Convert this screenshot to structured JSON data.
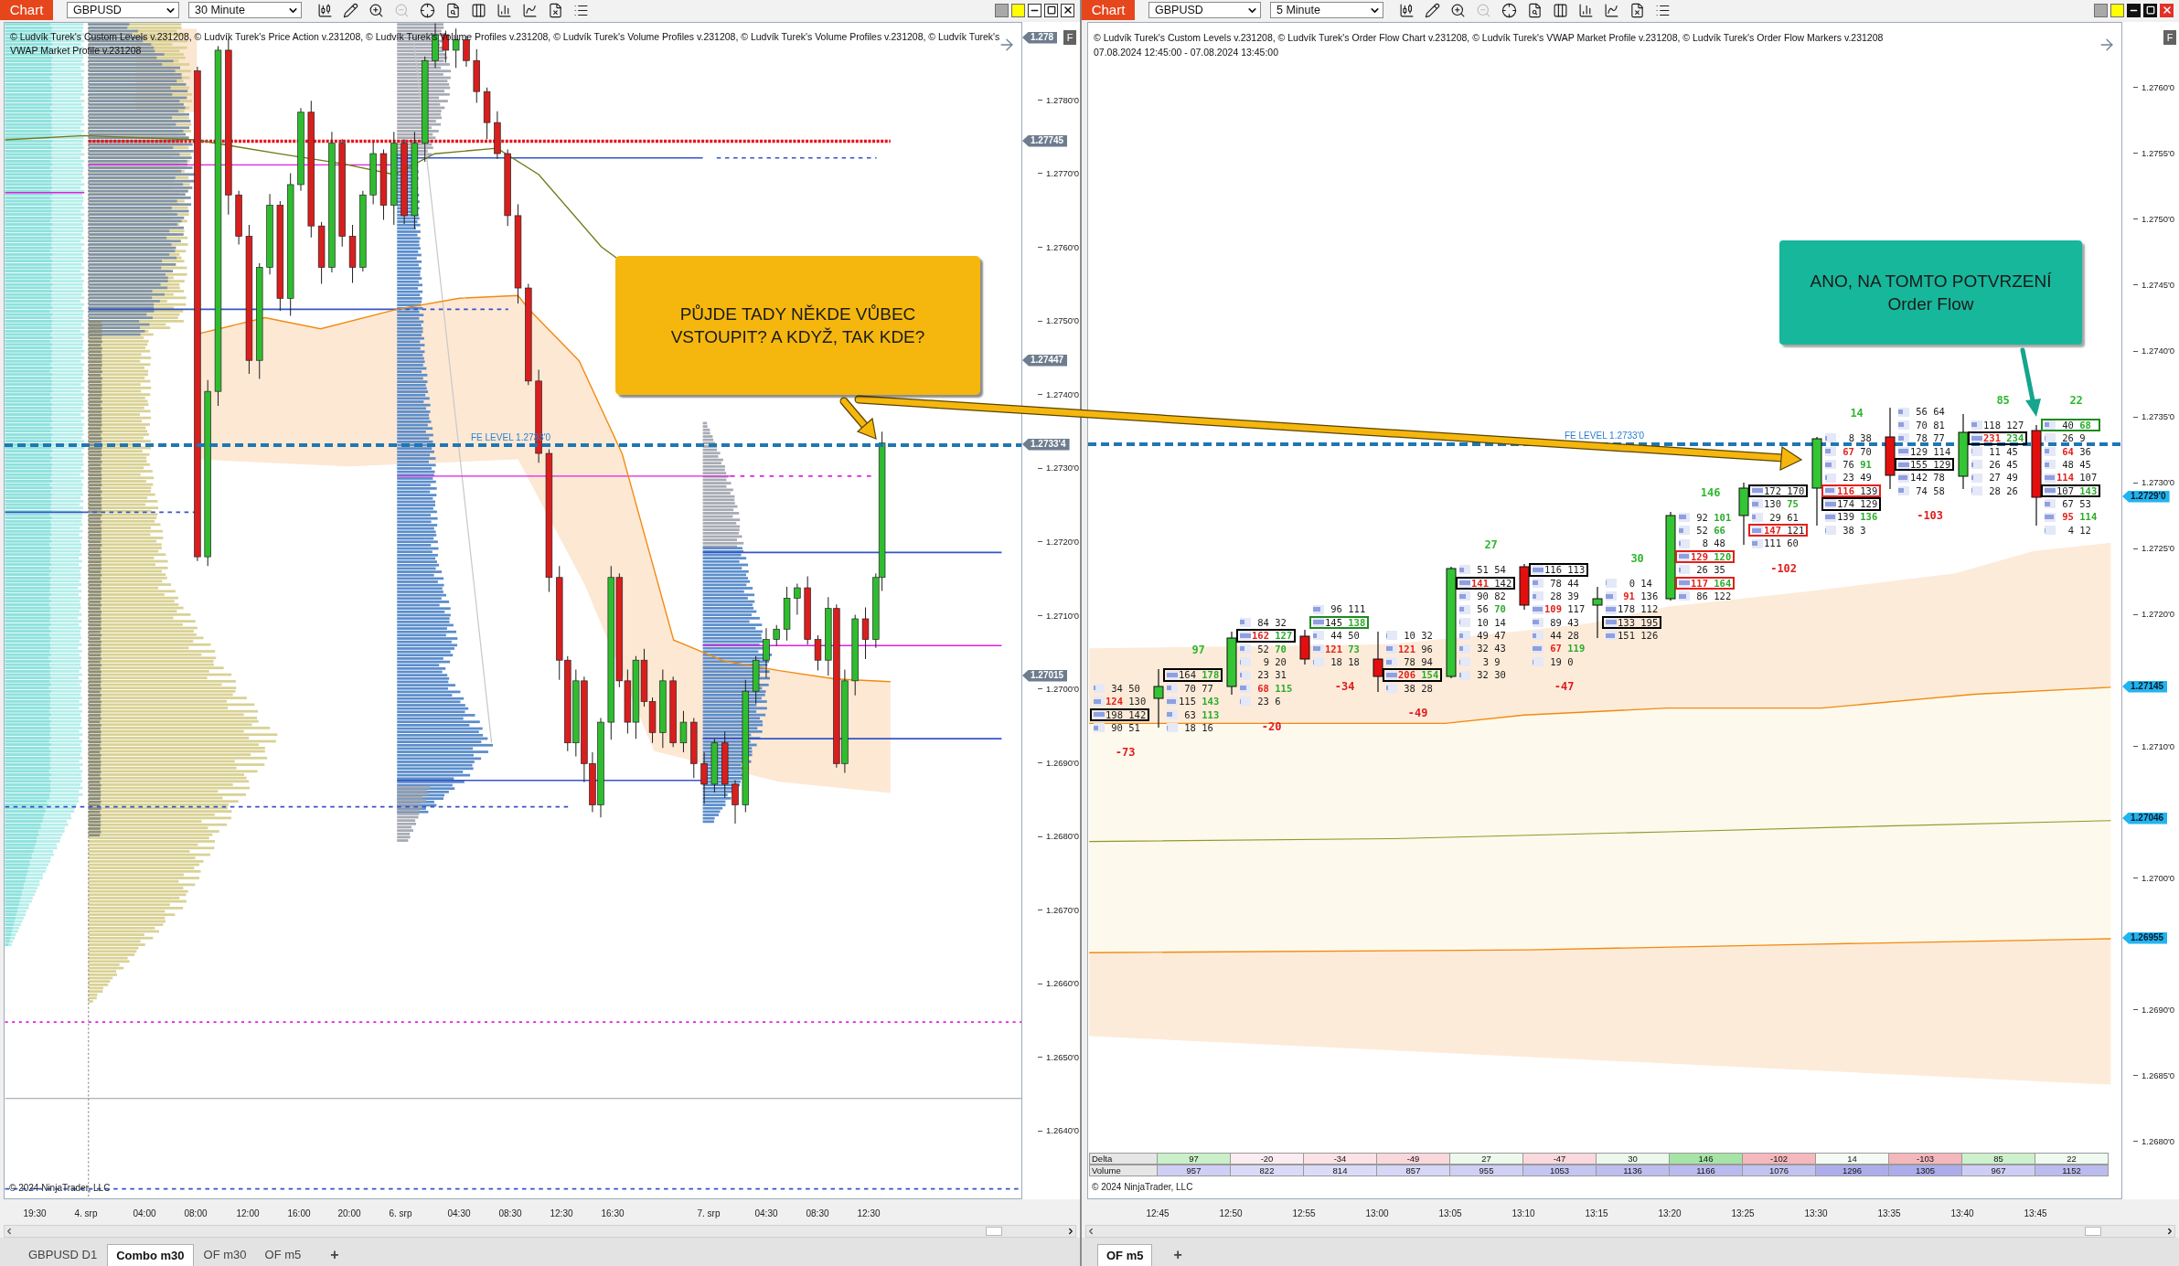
{
  "left_window": {
    "active": false,
    "toolbar": {
      "title": "Chart",
      "instrument": "GBPUSD",
      "timeframe": "30 Minute",
      "tools": [
        {
          "disabled": false
        },
        {
          "disabled": false
        },
        {
          "disabled": false
        },
        {
          "disabled": true
        },
        {
          "disabled": false
        },
        {
          "disabled": false
        },
        {
          "disabled": false
        },
        {
          "disabled": false
        },
        {
          "disabled": false
        },
        {
          "disabled": false
        },
        {
          "disabled": false
        }
      ],
      "links": [
        {
          "color": "#a9a9a9"
        },
        {
          "color": "#ffff00"
        }
      ]
    },
    "header_lines": [
      "© Ludvík Turek's Custom Levels v.231208, © Ludvík Turek's Price Action v.231208, © Ludvík Turek's Volume Profiles v.231208, © Ludvík Turek's Volume Profiles v.231208, © Ludvík Turek's Volume Profiles v.231208, © Ludvík Turek's",
      "VWAP Market Profile v.231208"
    ],
    "axis_button": "F",
    "fe_level_label": "FE LEVEL 1.2733'0",
    "price_ticks": [
      "1.2780'0",
      "1.2770'0",
      "1.2760'0",
      "1.2750'0",
      "1.2740'0",
      "1.2730'0",
      "1.2720'0",
      "1.2710'0",
      "1.2700'0",
      "1.2690'0",
      "1.2680'0",
      "1.2670'0",
      "1.2660'0",
      "1.2650'0",
      "1.2640'0"
    ],
    "price_markers": [
      "1.278",
      "1.27745",
      "1.27447",
      "1.2733'4",
      "1.27015"
    ],
    "copyright": "© 2024 NinjaTrader, LLC",
    "time_labels": [
      "19:30",
      "4. srp",
      "04:00",
      "08:00",
      "12:00",
      "16:00",
      "20:00",
      "6. srp",
      "04:30",
      "08:30",
      "12:30",
      "16:30",
      "7. srp",
      "04:30",
      "08:30",
      "12:30"
    ],
    "tabs": [
      {
        "label": "GBPUSD D1",
        "selected": false
      },
      {
        "label": "Combo m30",
        "selected": true
      },
      {
        "label": "OF m30",
        "selected": false
      },
      {
        "label": "OF m5",
        "selected": false
      }
    ],
    "add_tab": "+"
  },
  "right_window": {
    "active": true,
    "toolbar": {
      "title": "Chart",
      "instrument": "GBPUSD",
      "timeframe": "5 Minute",
      "tools": [
        {
          "disabled": false
        },
        {
          "disabled": false
        },
        {
          "disabled": false
        },
        {
          "disabled": true
        },
        {
          "disabled": false
        },
        {
          "disabled": false
        },
        {
          "disabled": false
        },
        {
          "disabled": false
        },
        {
          "disabled": false
        },
        {
          "disabled": false
        },
        {
          "disabled": false
        }
      ],
      "links": [
        {
          "color": "#a9a9a9"
        },
        {
          "color": "#ffff00"
        }
      ]
    },
    "header_lines": [
      "© Ludvík Turek's Custom Levels v.231208, © Ludvík Turek's Order Flow Chart v.231208, © Ludvík Turek's VWAP Market Profile v.231208, © Ludvík Turek's Order Flow Markers v.231208",
      "07.08.2024 12:45:00 - 07.08.2024 13:45:00"
    ],
    "axis_button": "F",
    "fe_level_label": "FE LEVEL 1.2733'0",
    "price_ticks": [
      "1.2760'0",
      "1.2755'0",
      "1.2750'0",
      "1.2745'0",
      "1.2740'0",
      "1.2735'0",
      "1.2730'0",
      "1.2725'0",
      "1.2720'0",
      "1.2710'0",
      "1.2700'0",
      "1.2690'0",
      "1.2685'0",
      "1.2680'0"
    ],
    "price_markers": [
      "1.2729'0",
      "1.27145",
      "1.27046",
      "1.26955"
    ],
    "footprint": [
      {
        "delta": "-73",
        "delta_positive": false,
        "rows": [
          {
            "bid": "34",
            "ask": "50",
            "bid_imbalance": false,
            "ask_imbalance": false,
            "level": 0.2
          },
          {
            "bid": "124",
            "ask": "130",
            "bid_imbalance": true,
            "ask_imbalance": false,
            "level": 0.7
          },
          {
            "bid": "198",
            "ask": "142",
            "bid_imbalance": false,
            "ask_imbalance": false,
            "level": 1,
            "color": "#000000"
          },
          {
            "bid": "90",
            "ask": "51",
            "bid_imbalance": false,
            "ask_imbalance": false,
            "level": 0.4
          }
        ]
      },
      {
        "delta": "97",
        "delta_positive": true,
        "rows": [
          {
            "bid": "164",
            "ask": "178",
            "bid_imbalance": false,
            "ask_imbalance": true,
            "level": 1,
            "color": "#000000"
          },
          {
            "bid": "70",
            "ask": "77",
            "bid_imbalance": false,
            "ask_imbalance": false,
            "level": 0.4
          },
          {
            "bid": "115",
            "ask": "143",
            "bid_imbalance": false,
            "ask_imbalance": true,
            "level": 0.8
          },
          {
            "bid": "63",
            "ask": "113",
            "bid_imbalance": false,
            "ask_imbalance": true,
            "level": 0.5
          },
          {
            "bid": "18",
            "ask": "16",
            "bid_imbalance": false,
            "ask_imbalance": false,
            "level": 0.1
          }
        ]
      },
      {
        "delta": "-20",
        "delta_positive": false,
        "rows": [
          {
            "bid": "84",
            "ask": "32",
            "bid_imbalance": false,
            "ask_imbalance": false,
            "level": 0.4
          },
          {
            "bid": "162",
            "ask": "127",
            "bid_imbalance": true,
            "ask_imbalance": true,
            "level": 1,
            "color": "#000000"
          },
          {
            "bid": "52",
            "ask": "70",
            "bid_imbalance": false,
            "ask_imbalance": true,
            "level": 0.4
          },
          {
            "bid": "9",
            "ask": "20",
            "bid_imbalance": false,
            "ask_imbalance": false,
            "level": 0.1
          },
          {
            "bid": "23",
            "ask": "31",
            "bid_imbalance": false,
            "ask_imbalance": false,
            "level": 0.2
          },
          {
            "bid": "68",
            "ask": "115",
            "bid_imbalance": true,
            "ask_imbalance": true,
            "level": 0.6
          },
          {
            "bid": "23",
            "ask": "6",
            "bid_imbalance": false,
            "ask_imbalance": false,
            "level": 0.1
          }
        ]
      },
      {
        "delta": "-34",
        "delta_positive": false,
        "rows": [
          {
            "bid": "96",
            "ask": "111",
            "bid_imbalance": false,
            "ask_imbalance": false,
            "level": 0.7
          },
          {
            "bid": "145",
            "ask": "138",
            "bid_imbalance": false,
            "ask_imbalance": true,
            "level": 1,
            "color": "#1e8c1e"
          },
          {
            "bid": "44",
            "ask": "50",
            "bid_imbalance": false,
            "ask_imbalance": false,
            "level": 0.3
          },
          {
            "bid": "121",
            "ask": "73",
            "bid_imbalance": true,
            "ask_imbalance": true,
            "level": 0.7
          },
          {
            "bid": "18",
            "ask": "18",
            "bid_imbalance": false,
            "ask_imbalance": false,
            "level": 0.1
          }
        ]
      },
      {
        "delta": "-49",
        "delta_positive": false,
        "rows": [
          {
            "bid": "10",
            "ask": "32",
            "bid_imbalance": false,
            "ask_imbalance": false,
            "level": 0.1
          },
          {
            "bid": "121",
            "ask": "96",
            "bid_imbalance": true,
            "ask_imbalance": false,
            "level": 0.6
          },
          {
            "bid": "78",
            "ask": "94",
            "bid_imbalance": false,
            "ask_imbalance": false,
            "level": 0.5
          },
          {
            "bid": "206",
            "ask": "154",
            "bid_imbalance": true,
            "ask_imbalance": true,
            "level": 1,
            "color": "#000000"
          },
          {
            "bid": "38",
            "ask": "28",
            "bid_imbalance": false,
            "ask_imbalance": false,
            "level": 0.2
          }
        ]
      },
      {
        "delta": "27",
        "delta_positive": true,
        "rows": [
          {
            "bid": "51",
            "ask": "54",
            "bid_imbalance": false,
            "ask_imbalance": false,
            "level": 0.4
          },
          {
            "bid": "141",
            "ask": "142",
            "bid_imbalance": true,
            "ask_imbalance": false,
            "level": 1,
            "color": "#000000"
          },
          {
            "bid": "90",
            "ask": "82",
            "bid_imbalance": false,
            "ask_imbalance": false,
            "level": 0.6
          },
          {
            "bid": "56",
            "ask": "70",
            "bid_imbalance": false,
            "ask_imbalance": true,
            "level": 0.4
          },
          {
            "bid": "10",
            "ask": "14",
            "bid_imbalance": false,
            "ask_imbalance": false,
            "level": 0.1
          },
          {
            "bid": "49",
            "ask": "47",
            "bid_imbalance": false,
            "ask_imbalance": false,
            "level": 0.3
          },
          {
            "bid": "32",
            "ask": "43",
            "bid_imbalance": false,
            "ask_imbalance": false,
            "level": 0.3
          },
          {
            "bid": "3",
            "ask": "9",
            "bid_imbalance": false,
            "ask_imbalance": false,
            "level": 0.1
          },
          {
            "bid": "32",
            "ask": "30",
            "bid_imbalance": false,
            "ask_imbalance": false,
            "level": 0.2
          }
        ]
      },
      {
        "delta": "-47",
        "delta_positive": false,
        "rows": [
          {
            "bid": "116",
            "ask": "113",
            "bid_imbalance": false,
            "ask_imbalance": false,
            "level": 1,
            "color": "#000000"
          },
          {
            "bid": "78",
            "ask": "44",
            "bid_imbalance": false,
            "ask_imbalance": false,
            "level": 0.5
          },
          {
            "bid": "28",
            "ask": "39",
            "bid_imbalance": false,
            "ask_imbalance": false,
            "level": 0.3
          },
          {
            "bid": "109",
            "ask": "117",
            "bid_imbalance": true,
            "ask_imbalance": false,
            "level": 0.9
          },
          {
            "bid": "89",
            "ask": "43",
            "bid_imbalance": false,
            "ask_imbalance": false,
            "level": 0.6
          },
          {
            "bid": "44",
            "ask": "28",
            "bid_imbalance": false,
            "ask_imbalance": false,
            "level": 0.3
          },
          {
            "bid": "67",
            "ask": "119",
            "bid_imbalance": true,
            "ask_imbalance": true,
            "level": 0.8
          },
          {
            "bid": "19",
            "ask": "0",
            "bid_imbalance": false,
            "ask_imbalance": false,
            "level": 0.1
          }
        ]
      },
      {
        "delta": "30",
        "delta_positive": true,
        "rows": [
          {
            "bid": "0",
            "ask": "14",
            "bid_imbalance": false,
            "ask_imbalance": false,
            "level": 0.1
          },
          {
            "bid": "91",
            "ask": "136",
            "bid_imbalance": true,
            "ask_imbalance": false,
            "level": 0.7
          },
          {
            "bid": "178",
            "ask": "112",
            "bid_imbalance": false,
            "ask_imbalance": false,
            "level": 0.9
          },
          {
            "bid": "133",
            "ask": "195",
            "bid_imbalance": false,
            "ask_imbalance": false,
            "level": 1,
            "color": "#000000"
          },
          {
            "bid": "151",
            "ask": "126",
            "bid_imbalance": false,
            "ask_imbalance": false,
            "level": 0.8
          }
        ]
      },
      {
        "delta": "146",
        "delta_positive": true,
        "rows": [
          {
            "bid": "92",
            "ask": "101",
            "bid_imbalance": false,
            "ask_imbalance": true,
            "level": 0.7
          },
          {
            "bid": "52",
            "ask": "66",
            "bid_imbalance": false,
            "ask_imbalance": true,
            "level": 0.4
          },
          {
            "bid": "8",
            "ask": "48",
            "bid_imbalance": false,
            "ask_imbalance": false,
            "level": 0.2
          },
          {
            "bid": "129",
            "ask": "120",
            "bid_imbalance": true,
            "ask_imbalance": true,
            "level": 0.9,
            "color": "#e3201b"
          },
          {
            "bid": "26",
            "ask": "35",
            "bid_imbalance": false,
            "ask_imbalance": false,
            "level": 0.2
          },
          {
            "bid": "117",
            "ask": "164",
            "bid_imbalance": true,
            "ask_imbalance": true,
            "level": 1,
            "color": "#e3201b"
          },
          {
            "bid": "86",
            "ask": "122",
            "bid_imbalance": false,
            "ask_imbalance": false,
            "level": 0.7
          }
        ]
      },
      {
        "delta": "-102",
        "delta_positive": false,
        "rows": [
          {
            "bid": "172",
            "ask": "170",
            "bid_imbalance": false,
            "ask_imbalance": false,
            "level": 1,
            "color": "#000000"
          },
          {
            "bid": "130",
            "ask": "75",
            "bid_imbalance": false,
            "ask_imbalance": true,
            "level": 0.6
          },
          {
            "bid": "29",
            "ask": "61",
            "bid_imbalance": false,
            "ask_imbalance": false,
            "level": 0.3
          },
          {
            "bid": "147",
            "ask": "121",
            "bid_imbalance": true,
            "ask_imbalance": false,
            "level": 0.8,
            "color": "#e3201b"
          },
          {
            "bid": "111",
            "ask": "60",
            "bid_imbalance": false,
            "ask_imbalance": false,
            "level": 0.5
          }
        ]
      },
      {
        "delta": "14",
        "delta_positive": true,
        "rows": [
          {
            "bid": "8",
            "ask": "38",
            "bid_imbalance": false,
            "ask_imbalance": false,
            "level": 0.2
          },
          {
            "bid": "67",
            "ask": "70",
            "bid_imbalance": true,
            "ask_imbalance": false,
            "level": 0.5
          },
          {
            "bid": "76",
            "ask": "91",
            "bid_imbalance": false,
            "ask_imbalance": true,
            "level": 0.6
          },
          {
            "bid": "23",
            "ask": "49",
            "bid_imbalance": false,
            "ask_imbalance": false,
            "level": 0.2
          },
          {
            "bid": "116",
            "ask": "139",
            "bid_imbalance": true,
            "ask_imbalance": false,
            "level": 0.8,
            "color": "#e3201b"
          },
          {
            "bid": "174",
            "ask": "129",
            "bid_imbalance": false,
            "ask_imbalance": false,
            "level": 1,
            "color": "#000000"
          },
          {
            "bid": "139",
            "ask": "136",
            "bid_imbalance": false,
            "ask_imbalance": true,
            "level": 0.9
          },
          {
            "bid": "38",
            "ask": "3",
            "bid_imbalance": false,
            "ask_imbalance": false,
            "level": 0.1
          }
        ]
      },
      {
        "delta": "-103",
        "delta_positive": false,
        "rows": [
          {
            "bid": "56",
            "ask": "64",
            "bid_imbalance": false,
            "ask_imbalance": false,
            "level": 0.4
          },
          {
            "bid": "70",
            "ask": "81",
            "bid_imbalance": false,
            "ask_imbalance": false,
            "level": 0.5
          },
          {
            "bid": "78",
            "ask": "77",
            "bid_imbalance": false,
            "ask_imbalance": false,
            "level": 0.5
          },
          {
            "bid": "129",
            "ask": "114",
            "bid_imbalance": false,
            "ask_imbalance": false,
            "level": 0.9
          },
          {
            "bid": "155",
            "ask": "129",
            "bid_imbalance": false,
            "ask_imbalance": false,
            "level": 1,
            "color": "#000000"
          },
          {
            "bid": "142",
            "ask": "78",
            "bid_imbalance": false,
            "ask_imbalance": false,
            "level": 0.8
          },
          {
            "bid": "74",
            "ask": "58",
            "bid_imbalance": false,
            "ask_imbalance": false,
            "level": 0.5
          }
        ]
      },
      {
        "delta": "85",
        "delta_positive": true,
        "rows": [
          {
            "bid": "118",
            "ask": "127",
            "bid_imbalance": false,
            "ask_imbalance": false,
            "level": 0.5
          },
          {
            "bid": "231",
            "ask": "234",
            "bid_imbalance": true,
            "ask_imbalance": true,
            "level": 1,
            "color": "#000000"
          },
          {
            "bid": "11",
            "ask": "45",
            "bid_imbalance": false,
            "ask_imbalance": false,
            "level": 0.1
          },
          {
            "bid": "26",
            "ask": "45",
            "bid_imbalance": false,
            "ask_imbalance": false,
            "level": 0.2
          },
          {
            "bid": "27",
            "ask": "49",
            "bid_imbalance": false,
            "ask_imbalance": false,
            "level": 0.2
          },
          {
            "bid": "28",
            "ask": "26",
            "bid_imbalance": false,
            "ask_imbalance": false,
            "level": 0.1
          }
        ]
      },
      {
        "delta": "22",
        "delta_positive": true,
        "rows": [
          {
            "bid": "40",
            "ask": "68",
            "bid_imbalance": false,
            "ask_imbalance": true,
            "level": 0.4,
            "color": "#1e8c1e"
          },
          {
            "bid": "26",
            "ask": "9",
            "bid_imbalance": false,
            "ask_imbalance": false,
            "level": 0.1
          },
          {
            "bid": "64",
            "ask": "36",
            "bid_imbalance": true,
            "ask_imbalance": false,
            "level": 0.4
          },
          {
            "bid": "48",
            "ask": "45",
            "bid_imbalance": false,
            "ask_imbalance": false,
            "level": 0.4
          },
          {
            "bid": "114",
            "ask": "107",
            "bid_imbalance": true,
            "ask_imbalance": false,
            "level": 0.9
          },
          {
            "bid": "107",
            "ask": "143",
            "bid_imbalance": false,
            "ask_imbalance": true,
            "level": 1,
            "color": "#000000"
          },
          {
            "bid": "67",
            "ask": "53",
            "bid_imbalance": false,
            "ask_imbalance": false,
            "level": 0.5
          },
          {
            "bid": "95",
            "ask": "114",
            "bid_imbalance": true,
            "ask_imbalance": true,
            "level": 0.8
          },
          {
            "bid": "4",
            "ask": "12",
            "bid_imbalance": false,
            "ask_imbalance": false,
            "level": 0.1
          }
        ]
      }
    ],
    "table": {
      "rows": [
        {
          "label": "Delta",
          "cells": [
            {
              "text": "97",
              "color": "#c9f0c9"
            },
            {
              "text": "-20",
              "color": "#fbedef"
            },
            {
              "text": "-34",
              "color": "#fbe2e5"
            },
            {
              "text": "-49",
              "color": "#f9d8dc"
            },
            {
              "text": "27",
              "color": "#edf9ed"
            },
            {
              "text": "-47",
              "color": "#f9d9dd"
            },
            {
              "text": "30",
              "color": "#ebf8eb"
            },
            {
              "text": "146",
              "color": "#a6e3a6"
            },
            {
              "text": "-102",
              "color": "#f4b8bd"
            },
            {
              "text": "14",
              "color": "#f4fbf4"
            },
            {
              "text": "-103",
              "color": "#f4b7bc"
            },
            {
              "text": "85",
              "color": "#cdf1cd"
            },
            {
              "text": "22",
              "color": "#f0faf0"
            }
          ]
        },
        {
          "label": "Volume",
          "cells": [
            {
              "text": "957",
              "color": "#cfcff5"
            },
            {
              "text": "822",
              "color": "#dadaf8"
            },
            {
              "text": "814",
              "color": "#dbdbf8"
            },
            {
              "text": "857",
              "color": "#d6d6f6"
            },
            {
              "text": "955",
              "color": "#d0d0f5"
            },
            {
              "text": "1053",
              "color": "#c5c5f2"
            },
            {
              "text": "1136",
              "color": "#bdbdf0"
            },
            {
              "text": "1166",
              "color": "#babaef"
            },
            {
              "text": "1076",
              "color": "#c3c3f1"
            },
            {
              "text": "1296",
              "color": "#adadec"
            },
            {
              "text": "1305",
              "color": "#acacec"
            },
            {
              "text": "967",
              "color": "#cecef5"
            },
            {
              "text": "1152",
              "color": "#bbbbef"
            }
          ]
        }
      ]
    },
    "copyright": "© 2024 NinjaTrader, LLC",
    "time_labels": [
      "12:45",
      "12:50",
      "12:55",
      "13:00",
      "13:05",
      "13:10",
      "13:15",
      "13:20",
      "13:25",
      "13:30",
      "13:35",
      "13:40",
      "13:45"
    ],
    "tabs": [
      {
        "label": "OF m5",
        "selected": true
      }
    ],
    "add_tab": "+"
  },
  "callouts": [
    {
      "text": "PŮJDE TADY NĚKDE VŮBEC VSTOUPIT? A KDYŽ, TAK KDE?",
      "color": "#f5b70e"
    },
    {
      "text": "ANO, NA TOMTO POTVRZENÍ Order Flow",
      "color": "#17b79b"
    }
  ]
}
